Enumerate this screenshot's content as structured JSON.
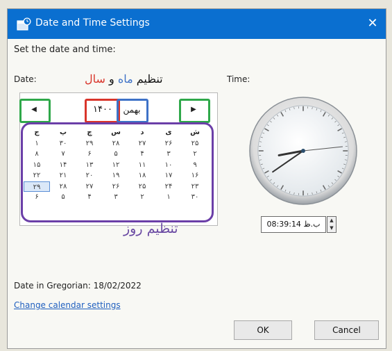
{
  "window": {
    "title": "Date and Time Settings",
    "close_glyph": "✕"
  },
  "heading": "Set the date and time:",
  "date_label": "Date:",
  "time_label": "Time:",
  "annotations": {
    "top_part1": "تنظیم",
    "top_part2": "ماه",
    "top_part3": "و",
    "top_part4": "سال",
    "bottom": "تنظیم روز",
    "colors": {
      "red": "#d9352b",
      "blue": "#3e72c7",
      "green": "#2fa84a",
      "purple": "#6b3fa8"
    }
  },
  "calendar": {
    "prev_glyph": "◀",
    "next_glyph": "▶",
    "year": "۱۴۰۰",
    "month": "بهمن",
    "weekday_headers": [
      "ش",
      "ی",
      "د",
      "س",
      "چ",
      "پ",
      "ج"
    ],
    "rows": [
      [
        "۲۵",
        "۲۶",
        "۲۷",
        "۲۸",
        "۲۹",
        "۳۰",
        "۱"
      ],
      [
        "۲",
        "۳",
        "۴",
        "۵",
        "۶",
        "۷",
        "۸"
      ],
      [
        "۹",
        "۱۰",
        "۱۱",
        "۱۲",
        "۱۳",
        "۱۴",
        "۱۵"
      ],
      [
        "۱۶",
        "۱۷",
        "۱۸",
        "۱۹",
        "۲۰",
        "۲۱",
        "۲۲"
      ],
      [
        "۲۳",
        "۲۴",
        "۲۵",
        "۲۶",
        "۲۷",
        "۲۸",
        "۲۹"
      ],
      [
        "۳۰",
        "۱",
        "۲",
        "۳",
        "۴",
        "۵",
        "۶"
      ]
    ],
    "selected_day": "۲۹"
  },
  "clock": {
    "hour": 8,
    "minute": 39,
    "second": 14
  },
  "time_value": "08:39:14 ب.ظ",
  "gregorian": "Date in Gregorian: 18/02/2022",
  "change_link": "Change calendar settings",
  "buttons": {
    "ok": "OK",
    "cancel": "Cancel"
  }
}
